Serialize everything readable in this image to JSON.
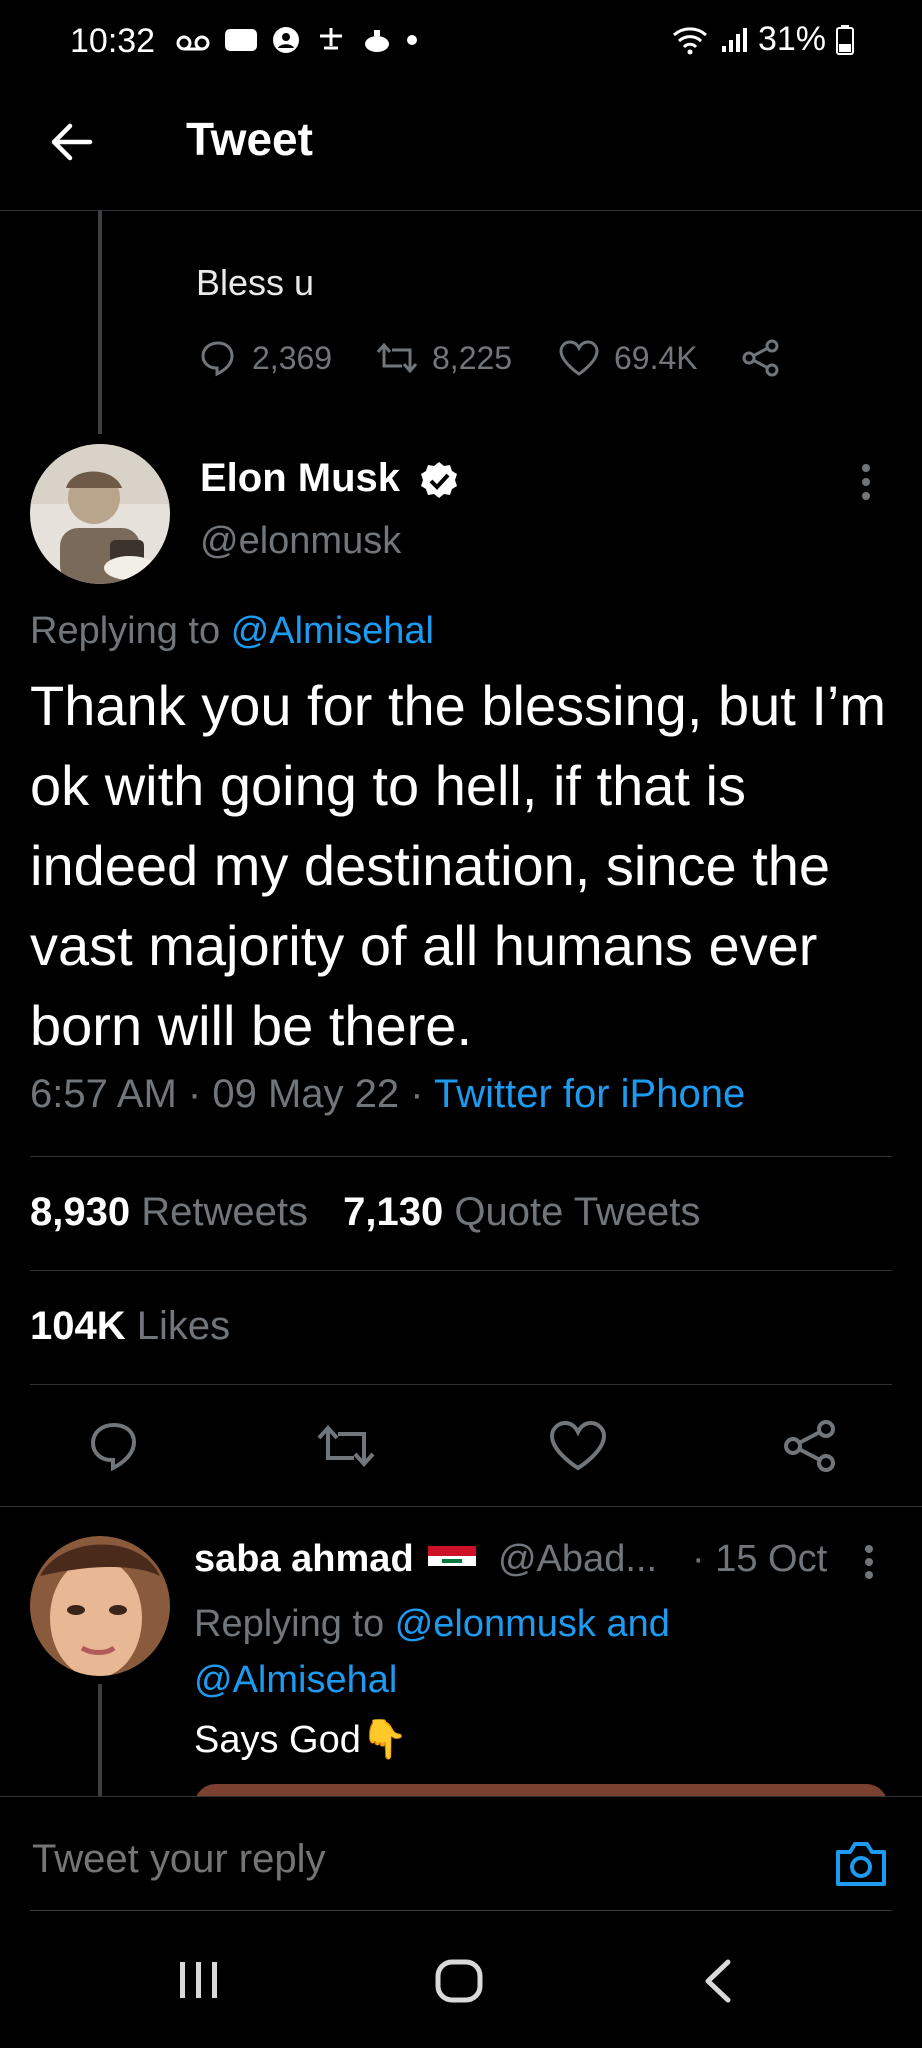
{
  "status_bar": {
    "time": "10:32",
    "battery": "31%"
  },
  "header": {
    "title": "Tweet"
  },
  "parent_tweet": {
    "text": "Bless u",
    "replies": "2,369",
    "retweets": "8,225",
    "likes": "69.4K"
  },
  "tweet": {
    "author_name": "Elon Musk",
    "handle": "@elonmusk",
    "replying_prefix": "Replying to",
    "replying_to": "@Almisehal",
    "text": "Thank you for the blessing, but I’m ok with going to hell, if that is indeed my destination, since the vast majority of all humans ever born will be there.",
    "time": "6:57 AM",
    "date": "09 May 22",
    "source": "Twitter for iPhone",
    "retweets_count": "8,930",
    "retweets_label": "Retweets",
    "quotes_count": "7,130",
    "quotes_label": "Quote Tweets",
    "likes_count": "104K",
    "likes_label": "Likes"
  },
  "reply": {
    "name": "saba ahmad",
    "handle": "@Abad...",
    "date": "· 15 Oct",
    "replying_prefix": "Replying to",
    "replying_to": "@elonmusk and @Almisehal",
    "text": "Says God",
    "emoji": "👇"
  },
  "compose": {
    "placeholder": "Tweet your reply"
  },
  "colors": {
    "accent": "#1d9bf0",
    "muted": "#71767b",
    "background": "#000000",
    "divider": "#2f3336"
  }
}
